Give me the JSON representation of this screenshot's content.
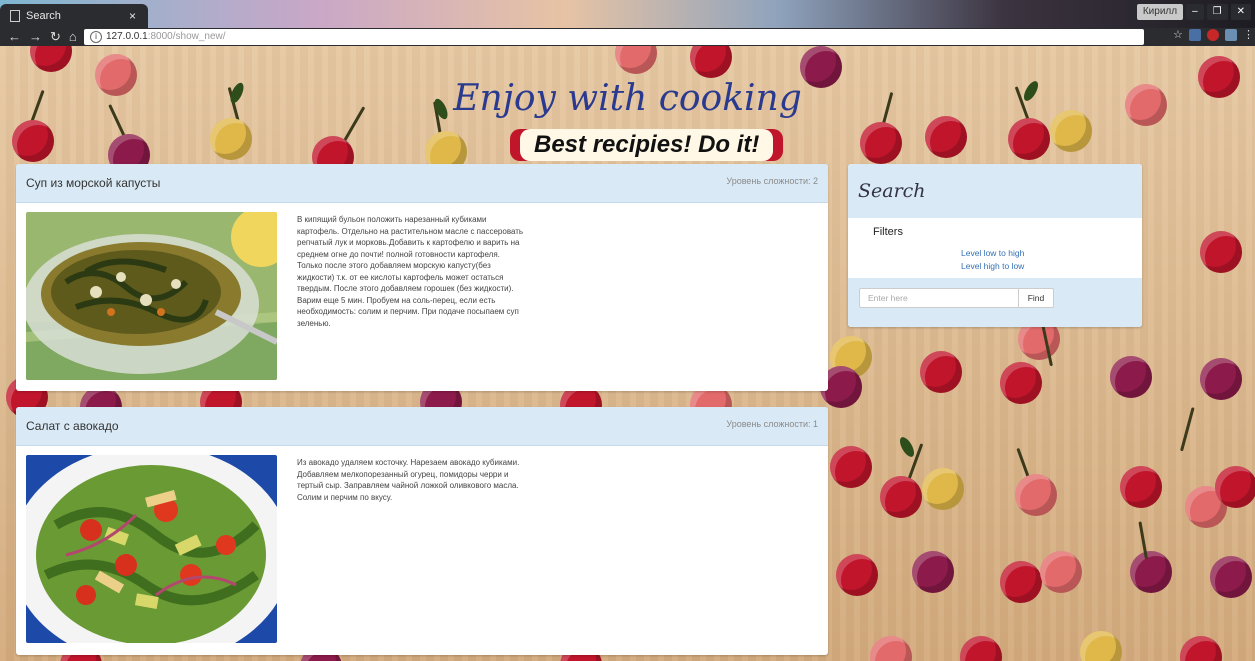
{
  "browser": {
    "tab_title": "Search",
    "url_host": "127.0.0.1",
    "url_rest": ":8000/show_new/",
    "user_name": "Кирилл"
  },
  "site": {
    "title": "Enjoy with cooking",
    "banner": "Best recipies! Do it!"
  },
  "recipes": [
    {
      "title": "Суп из морской капусты",
      "level": "Уровень сложности: 2",
      "image_name": "seaweed-soup-photo",
      "description": "В кипящий бульон положить нарезанный кубиками картофель. Отдельно на растительном масле с пассеровать репчатый лук и морковь.Добавить к картофелю и варить на среднем огне до почти! полной готовности картофеля. Только после этого добавляем морскую капусту(без жидкости) т.к. от ее кислоты картофель может остаться твердым. После этого добавляем горошек (без жидкости). Варим еще 5 мин. Пробуем на соль-перец, если есть необходимость: солим и перчим. При подаче посыпаем суп зеленью."
    },
    {
      "title": "Салат с авокадо",
      "level": "Уровень сложности: 1",
      "image_name": "avocado-salad-photo",
      "description": "Из авокадо удаляем косточку. Нарезаем авокадо кубиками. Добавляем мелкопорезанный огурец, помидоры черри и тертый сыр. Заправляем чайной ложкой оливкового масла. Солим и перчим по вкусу."
    }
  ],
  "search": {
    "title": "Search",
    "filters_label": "Filters",
    "filter_low_high": "Level low to high",
    "filter_high_low": "Level high to low",
    "placeholder": "Enter here",
    "find_label": "Find"
  }
}
